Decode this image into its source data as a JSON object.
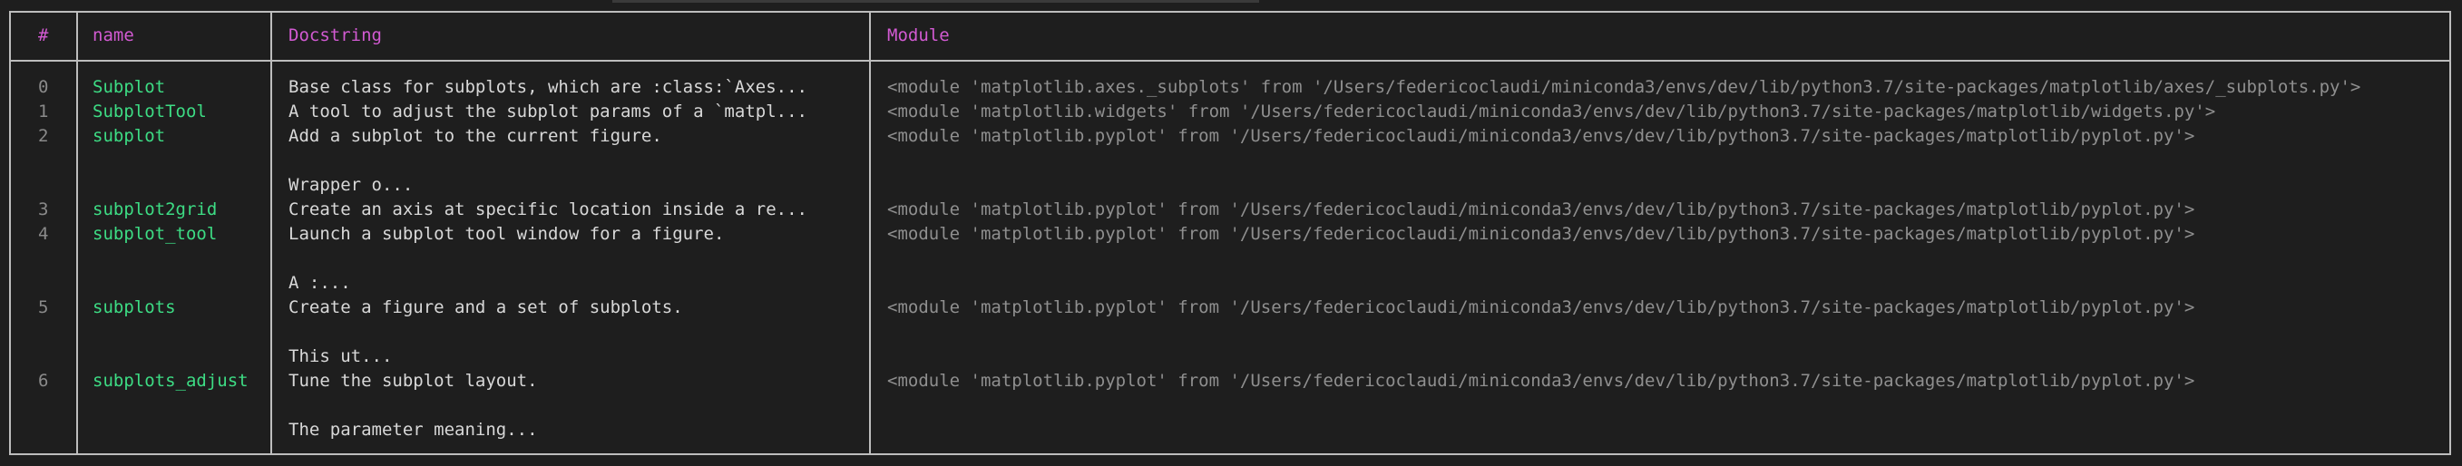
{
  "table": {
    "headers": {
      "index": "#",
      "name": "name",
      "docstring": "Docstring",
      "module": "Module"
    },
    "rows": [
      {
        "index": "0",
        "name": "Subplot",
        "doc": "Base class for subplots, which are :class:`Axes...",
        "module": "<module 'matplotlib.axes._subplots' from '/Users/federicoclaudi/miniconda3/envs/dev/lib/python3.7/site-packages/matplotlib/axes/_subplots.py'>"
      },
      {
        "index": "1",
        "name": "SubplotTool",
        "doc": "A tool to adjust the subplot params of a `matpl...",
        "module": "<module 'matplotlib.widgets' from '/Users/federicoclaudi/miniconda3/envs/dev/lib/python3.7/site-packages/matplotlib/widgets.py'>"
      },
      {
        "index": "2",
        "name": "subplot",
        "doc": "Add a subplot to the current figure.",
        "doc_extra": "Wrapper o...",
        "module": "<module 'matplotlib.pyplot' from '/Users/federicoclaudi/miniconda3/envs/dev/lib/python3.7/site-packages/matplotlib/pyplot.py'>"
      },
      {
        "index": "3",
        "name": "subplot2grid",
        "doc": "Create an axis at specific location inside a re...",
        "module": "<module 'matplotlib.pyplot' from '/Users/federicoclaudi/miniconda3/envs/dev/lib/python3.7/site-packages/matplotlib/pyplot.py'>"
      },
      {
        "index": "4",
        "name": "subplot_tool",
        "doc": "Launch a subplot tool window for a figure.",
        "doc_extra": "A :...",
        "module": "<module 'matplotlib.pyplot' from '/Users/federicoclaudi/miniconda3/envs/dev/lib/python3.7/site-packages/matplotlib/pyplot.py'>"
      },
      {
        "index": "5",
        "name": "subplots",
        "doc": "Create a figure and a set of subplots.",
        "doc_extra": "This ut...",
        "module": "<module 'matplotlib.pyplot' from '/Users/federicoclaudi/miniconda3/envs/dev/lib/python3.7/site-packages/matplotlib/pyplot.py'>"
      },
      {
        "index": "6",
        "name": "subplots_adjust",
        "doc": "Tune the subplot layout.",
        "doc_extra": "The parameter meaning...",
        "module": "<module 'matplotlib.pyplot' from '/Users/federicoclaudi/miniconda3/envs/dev/lib/python3.7/site-packages/matplotlib/pyplot.py'>"
      }
    ]
  },
  "colors": {
    "header_text": "#d25ad2",
    "name_text": "#3ddc84",
    "border": "#bdbdbd",
    "background": "#1e1e1e"
  }
}
